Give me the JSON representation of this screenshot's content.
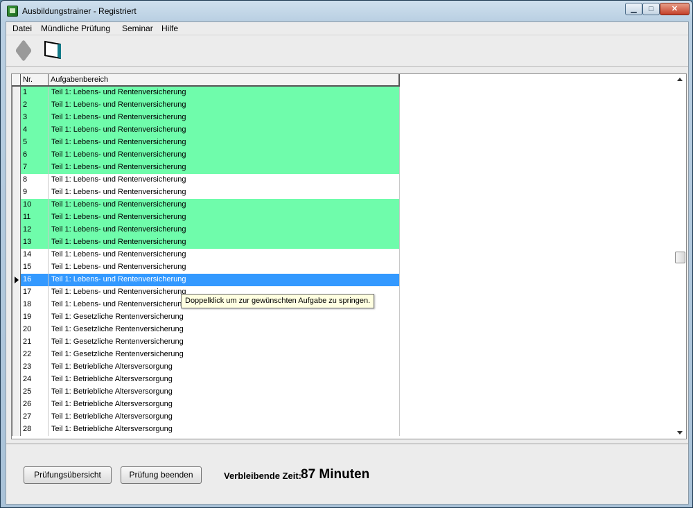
{
  "window": {
    "title": "Ausbildungstrainer - Registriert",
    "controls": {
      "minimize": "▁",
      "maximize": "□",
      "close": "✕"
    }
  },
  "menu": [
    "Datei",
    "Mündliche Prüfung",
    "Seminar",
    "Hilfe"
  ],
  "toolbar": {
    "icons": [
      "disabled-book-icon",
      "open-book-icon"
    ]
  },
  "grid": {
    "columns": [
      "Nr.",
      "Aufgabenbereich"
    ],
    "selected_index": 15,
    "rows": [
      {
        "nr": "1",
        "area": "Teil 1: Lebens- und Rentenversicherung",
        "state": "green"
      },
      {
        "nr": "2",
        "area": "Teil 1: Lebens- und Rentenversicherung",
        "state": "green"
      },
      {
        "nr": "3",
        "area": "Teil 1: Lebens- und Rentenversicherung",
        "state": "green"
      },
      {
        "nr": "4",
        "area": "Teil 1: Lebens- und Rentenversicherung",
        "state": "green"
      },
      {
        "nr": "5",
        "area": "Teil 1: Lebens- und Rentenversicherung",
        "state": "green"
      },
      {
        "nr": "6",
        "area": "Teil 1: Lebens- und Rentenversicherung",
        "state": "green"
      },
      {
        "nr": "7",
        "area": "Teil 1: Lebens- und Rentenversicherung",
        "state": "green"
      },
      {
        "nr": "8",
        "area": "Teil 1: Lebens- und Rentenversicherung",
        "state": "white"
      },
      {
        "nr": "9",
        "area": "Teil 1: Lebens- und Rentenversicherung",
        "state": "white"
      },
      {
        "nr": "10",
        "area": "Teil 1: Lebens- und Rentenversicherung",
        "state": "green"
      },
      {
        "nr": "11",
        "area": "Teil 1: Lebens- und Rentenversicherung",
        "state": "green"
      },
      {
        "nr": "12",
        "area": "Teil 1: Lebens- und Rentenversicherung",
        "state": "green"
      },
      {
        "nr": "13",
        "area": "Teil 1: Lebens- und Rentenversicherung",
        "state": "green"
      },
      {
        "nr": "14",
        "area": "Teil 1: Lebens- und Rentenversicherung",
        "state": "white"
      },
      {
        "nr": "15",
        "area": "Teil 1: Lebens- und Rentenversicherung",
        "state": "white"
      },
      {
        "nr": "16",
        "area": "Teil 1: Lebens- und Rentenversicherung",
        "state": "selected"
      },
      {
        "nr": "17",
        "area": "Teil 1: Lebens- und Rentenversicherung",
        "state": "white"
      },
      {
        "nr": "18",
        "area": "Teil 1: Lebens- und Rentenversicherung",
        "state": "white"
      },
      {
        "nr": "19",
        "area": "Teil 1: Gesetzliche Rentenversicherung",
        "state": "white"
      },
      {
        "nr": "20",
        "area": "Teil 1: Gesetzliche Rentenversicherung",
        "state": "white"
      },
      {
        "nr": "21",
        "area": "Teil 1: Gesetzliche Rentenversicherung",
        "state": "white"
      },
      {
        "nr": "22",
        "area": "Teil 1: Gesetzliche Rentenversicherung",
        "state": "white"
      },
      {
        "nr": "23",
        "area": "Teil 1: Betriebliche Altersversorgung",
        "state": "white"
      },
      {
        "nr": "24",
        "area": "Teil 1: Betriebliche Altersversorgung",
        "state": "white"
      },
      {
        "nr": "25",
        "area": "Teil 1: Betriebliche Altersversorgung",
        "state": "white"
      },
      {
        "nr": "26",
        "area": "Teil 1: Betriebliche Altersversorgung",
        "state": "white"
      },
      {
        "nr": "27",
        "area": "Teil 1: Betriebliche Altersversorgung",
        "state": "white"
      },
      {
        "nr": "28",
        "area": "Teil 1: Betriebliche Altersversorgung",
        "state": "white"
      }
    ]
  },
  "tooltip": "Doppelklick um zur gewünschten Aufgabe zu springen.",
  "footer": {
    "overview_button": "Prüfungsübersicht",
    "end_button": "Prüfung beenden",
    "time_label": "Verbleibende Zeit:",
    "time_value": "87 Minuten"
  },
  "colors": {
    "done": "#6ffcab",
    "selected": "#3399ff",
    "tooltip_bg": "#ffffe1"
  }
}
